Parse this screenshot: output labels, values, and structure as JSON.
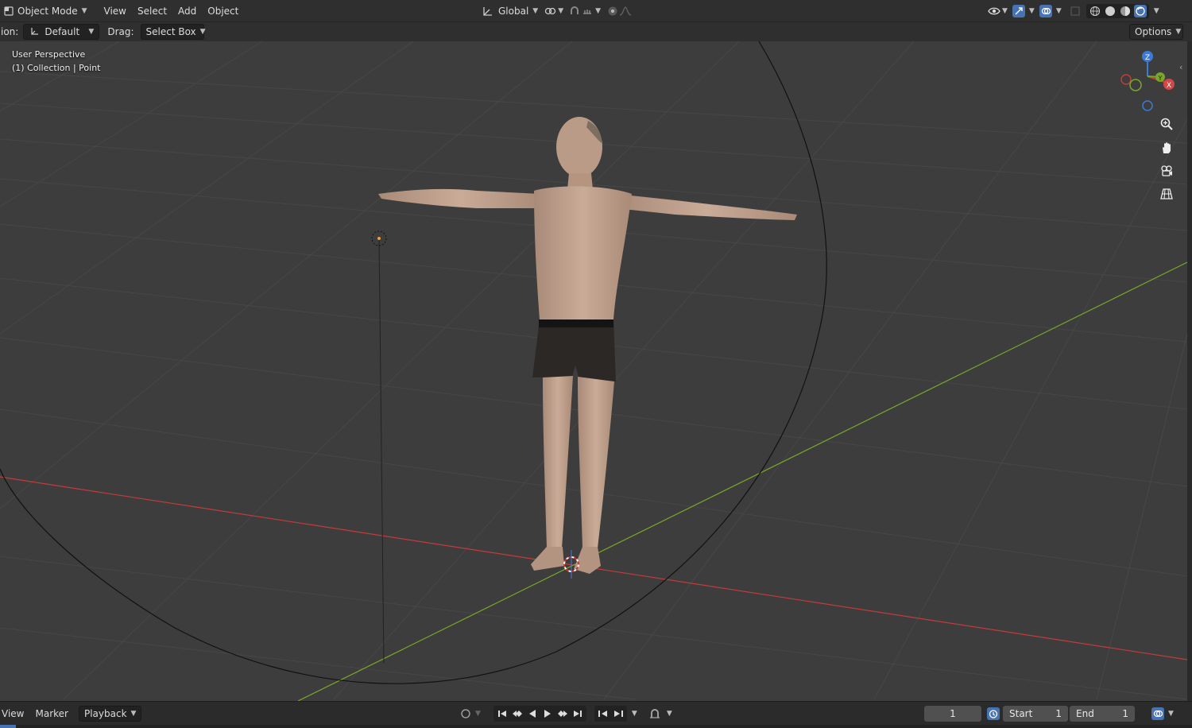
{
  "header": {
    "mode_label": "Object Mode",
    "menus": [
      "View",
      "Select",
      "Add",
      "Object"
    ],
    "orientation_label": "Global"
  },
  "toolsettings": {
    "orientation_prefix": "ion:",
    "orientation_value": "Default",
    "drag_label": "Drag:",
    "drag_value": "Select Box",
    "options_label": "Options"
  },
  "viewport": {
    "view_name": "User Perspective",
    "collection_label": "(1) Collection | Point",
    "gizmo": {
      "x": "X",
      "y": "Y",
      "z": "Z"
    },
    "colors": {
      "x_axis": "#c23c3c",
      "y_axis": "#78a82a",
      "z_axis": "#3c7ad8",
      "grid": "#4a4a4a",
      "background": "#3d3d3d"
    }
  },
  "timeline": {
    "menus": [
      "View",
      "Marker",
      "Playback"
    ],
    "current_frame": "1",
    "start_label": "Start",
    "start_value": "1",
    "end_label": "End",
    "end_value": "1"
  },
  "icons": [
    "editor-type-icon",
    "transform-orientation-icon",
    "pivot-icon",
    "snap-icon",
    "proportional-edit-icon",
    "visibility-icon",
    "gizmo-icon",
    "overlay-icon",
    "xray-icon",
    "solid-shading-icon",
    "material-shading-icon",
    "rendered-shading-icon",
    "zoom-icon",
    "hand-pan-icon",
    "camera-icon",
    "grid-view-icon",
    "keying-icon",
    "auto-key-icon"
  ]
}
